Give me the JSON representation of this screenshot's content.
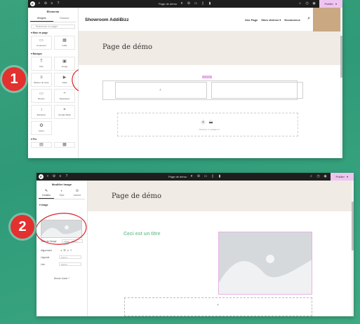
{
  "colors": {
    "background": "#3aa27c",
    "marker": "#e2312f",
    "publish": "#f0c4f1",
    "hero": "#f0ebe4",
    "accent_heading": "#7ac79a",
    "tan_block": "#c9a882"
  },
  "step1": {
    "number": "1",
    "topbar": {
      "page_label": "Page de démo",
      "publish_label": "Publier"
    },
    "panel": {
      "title": "Éléments",
      "tabs": [
        "Widgets",
        "Globaux"
      ],
      "search_placeholder": "Rechercher un widget",
      "section_layout": "Mise en page",
      "layout_widgets": [
        {
          "icon": "container-icon",
          "glyph": "▭",
          "label": "Conteneur"
        },
        {
          "icon": "grid-icon",
          "glyph": "▦",
          "label": "Grille"
        }
      ],
      "section_basic": "Basique",
      "basic_widgets": [
        {
          "icon": "heading-icon",
          "glyph": "T",
          "label": "Titre"
        },
        {
          "icon": "image-icon",
          "glyph": "▣",
          "label": "Image"
        },
        {
          "icon": "text-editor-icon",
          "glyph": "≡",
          "label": "Éditeur de texte"
        },
        {
          "icon": "video-icon",
          "glyph": "▶",
          "label": "Vidéo"
        },
        {
          "icon": "button-icon",
          "glyph": "▭",
          "label": "Bouton"
        },
        {
          "icon": "divider-icon",
          "glyph": "÷",
          "label": "Séparateur"
        },
        {
          "icon": "spacer-icon",
          "glyph": "↕",
          "label": "Espaceur"
        },
        {
          "icon": "google-maps-icon",
          "glyph": "⌖",
          "label": "Google Maps"
        },
        {
          "icon": "icon-widget-icon",
          "glyph": "✪",
          "label": "Icône"
        }
      ],
      "section_pro": "Pro"
    },
    "site": {
      "brand": "Showroom AddiBizz",
      "nav": [
        "One Page",
        "Sites vitrines ▾",
        "Ecommerce"
      ],
      "hero_title": "Page de démo",
      "drop_hint": "Déposer un widget ici"
    }
  },
  "step2": {
    "number": "2",
    "topbar": {
      "page_label": "Page de démo",
      "publish_label": "Publier"
    },
    "panel": {
      "title": "Modifier Image",
      "tabs": [
        "Contenu",
        "Style",
        "Avancé"
      ],
      "section_image": "Image",
      "fields": [
        {
          "label": "Taille de l'image",
          "value": "Large - 1024 x 1024"
        },
        {
          "label": "Alignement",
          "value": ""
        },
        {
          "label": "Légende",
          "value": "Aucun"
        },
        {
          "label": "Lien",
          "value": "Aucun"
        }
      ],
      "footer_hint": "Besoin d'aide ?"
    },
    "site": {
      "hero_title": "Page de démo",
      "heading": "Ceci est un titre"
    }
  }
}
